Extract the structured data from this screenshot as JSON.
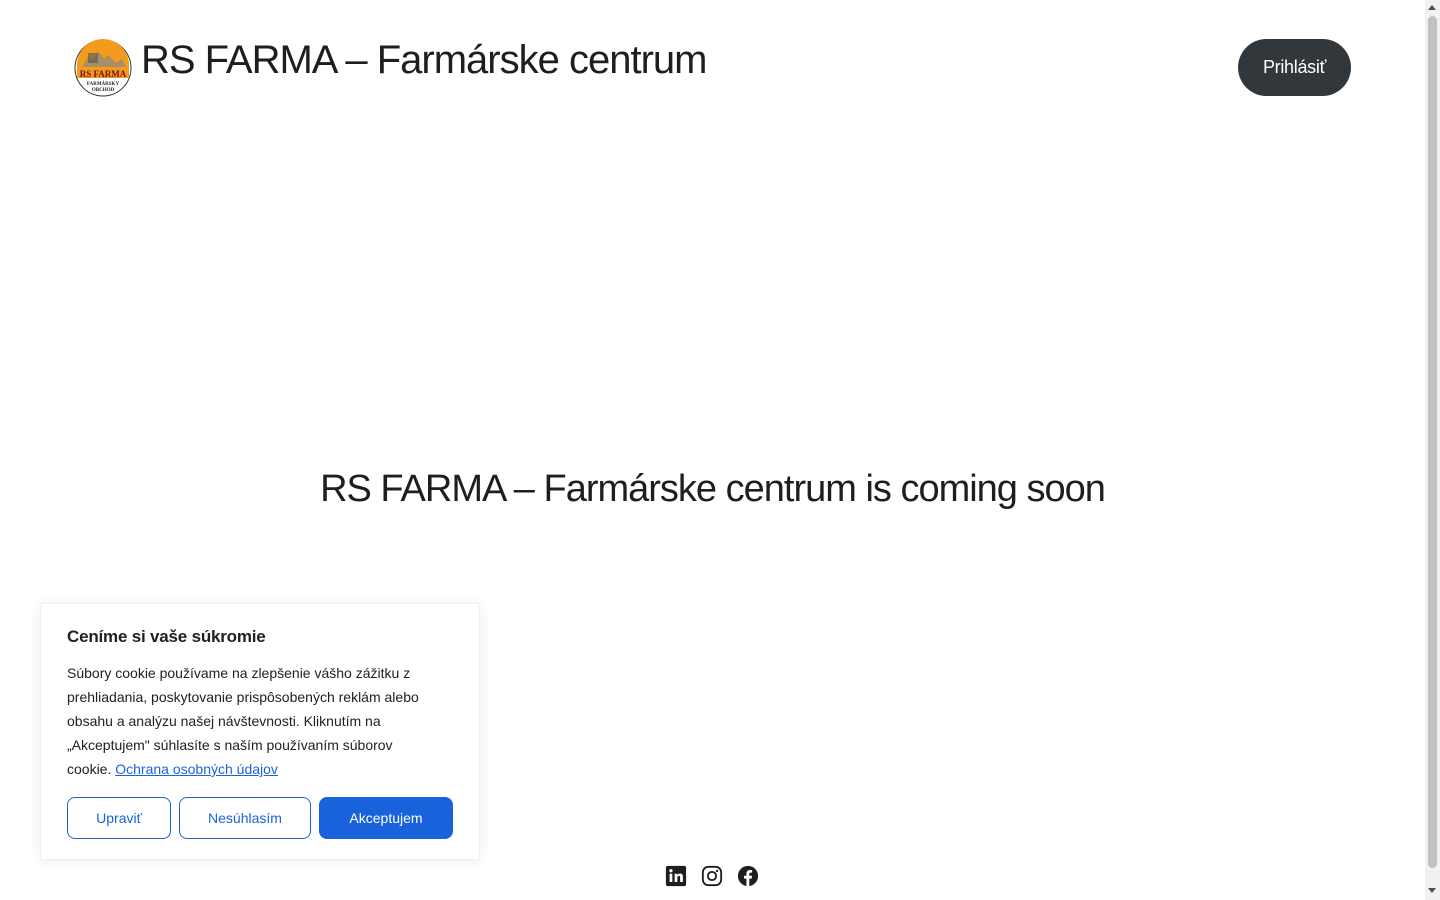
{
  "header": {
    "logo": {
      "icon": "rs-farma-logo",
      "text_line1": "RS FARMA",
      "text_line2": "FARMÁRSKY",
      "text_line3": "OBCHOD"
    },
    "site_title": "RS FARMA – Farmárske centrum",
    "login_label": "Prihlásiť"
  },
  "main": {
    "coming_soon_text": "RS FARMA – Farmárske centrum is coming soon"
  },
  "social": {
    "icons": [
      "linkedin-icon",
      "instagram-icon",
      "facebook-icon"
    ]
  },
  "cookie_banner": {
    "title": "Ceníme si vaše súkromie",
    "text": "Súbory cookie používame na zlepšenie vášho zážitku z prehliadania, poskytovanie prispôsobených reklám alebo obsahu a analýzu našej návštevnosti. Kliknutím na „Akceptujem\" súhlasíte s naším používaním súborov cookie.",
    "link_label": "Ochrana osobných údajov",
    "customize_label": "Upraviť",
    "reject_label": "Nesúhlasím",
    "accept_label": "Akceptujem"
  },
  "colors": {
    "login_button": "#32373c",
    "cookie_accent": "#1863dc",
    "text": "#1e1e1e"
  }
}
